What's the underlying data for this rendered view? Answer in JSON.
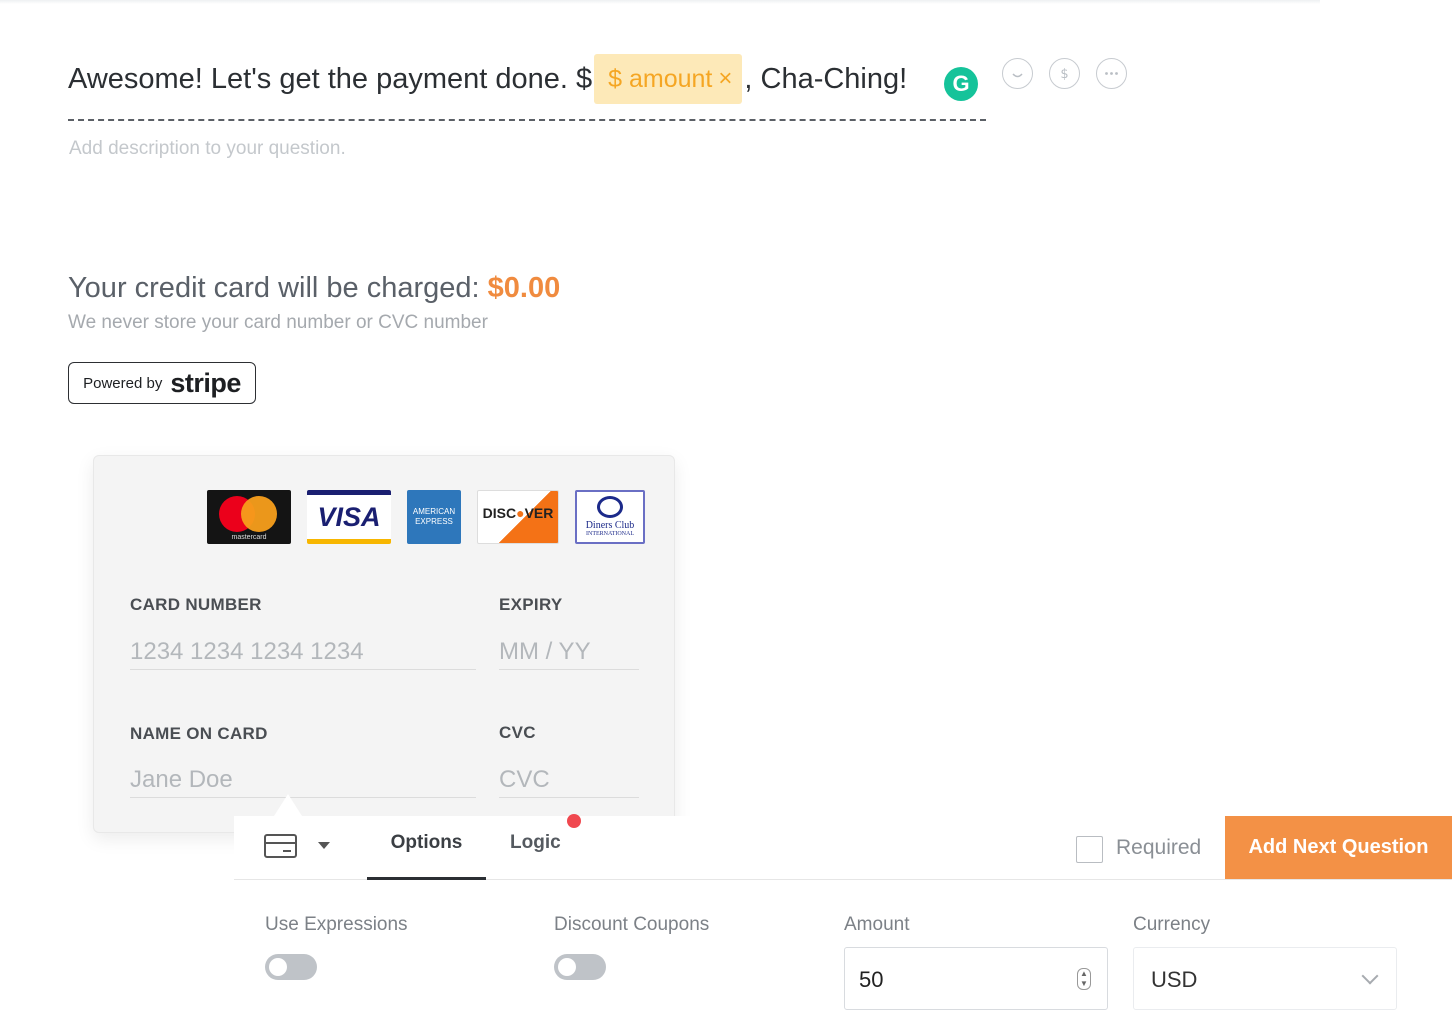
{
  "question": {
    "prefix": "Awesome! Let's get the payment done. $",
    "chip_label": "$ amount",
    "chip_close": "×",
    "suffix": ", Cha-Ching!",
    "description_placeholder": "Add description to your question."
  },
  "toolbar_icons": [
    "grammarly-icon",
    "emoji-icon",
    "dollar-icon",
    "more-icon"
  ],
  "grammarly_letter": "G",
  "charge": {
    "label": "Your credit card will be charged: ",
    "amount": "$0.00",
    "note": "We never store your card number or CVC number"
  },
  "stripe_badge": {
    "powered_by": "Powered by",
    "brand": "stripe"
  },
  "card_brands": {
    "mastercard": "mastercard",
    "visa": "VISA",
    "amex": "AMERICAN EXPRESS",
    "discover_a": "DISC",
    "discover_o": "●",
    "discover_b": "VER",
    "diners": "Diners Club",
    "diners_sub": "INTERNATIONAL"
  },
  "card_form": {
    "card_number_label": "CARD NUMBER",
    "card_number_placeholder": "1234 1234 1234 1234",
    "expiry_label": "EXPIRY",
    "expiry_placeholder": "MM / YY",
    "name_label": "NAME ON CARD",
    "name_placeholder": "Jane Doe",
    "cvc_label": "CVC",
    "cvc_placeholder": "CVC"
  },
  "panel": {
    "tabs": [
      {
        "label": "Options",
        "active": true
      },
      {
        "label": "Logic",
        "active": false
      }
    ],
    "required_label": "Required",
    "add_next_label": "Add Next Question",
    "options": {
      "use_expressions_label": "Use Expressions",
      "use_expressions_on": false,
      "discount_coupons_label": "Discount Coupons",
      "discount_coupons_on": false,
      "amount_label": "Amount",
      "amount_value": "50",
      "currency_label": "Currency",
      "currency_value": "USD"
    }
  },
  "colors": {
    "accent": "#f39146",
    "charge_amount": "#f08b3f",
    "chip_bg": "#fde9b8",
    "chip_text": "#f5a623",
    "grammarly": "#15c39a",
    "badge_dot": "#f0484f"
  }
}
